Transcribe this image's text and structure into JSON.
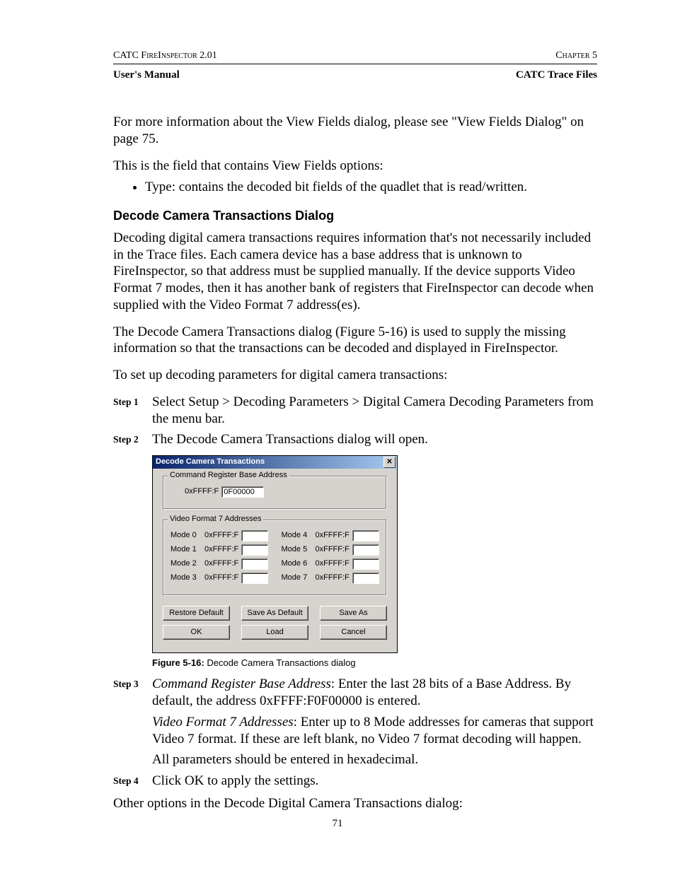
{
  "header": {
    "topLeft": "CATC FireInspector 2.01",
    "topRight": "Chapter 5",
    "bottomLeft": "User's Manual",
    "bottomRight": "CATC Trace Files"
  },
  "intro": {
    "p1": "For more information about the View Fields dialog, please see \"View Fields Dialog\" on page 75.",
    "p2": "This is the field that contains View Fields options:",
    "bullet1": "Type: contains the decoded bit fields of the quadlet that is read/written."
  },
  "section": {
    "title": "Decode Camera Transactions Dialog",
    "p1": "Decoding digital camera transactions requires information that's not necessarily included in the Trace files. Each camera device has a base address that is unknown to FireInspector, so that address must be supplied manually. If the device supports Video Format 7 modes, then it has another bank of registers that FireInspector can decode when supplied with the Video Format 7 address(es).",
    "p2": "The Decode Camera Transactions dialog (Figure 5-16) is used to supply the missing information so that the transactions can be decoded and displayed in FireInspector.",
    "p3": "To set up decoding parameters for digital camera transactions:"
  },
  "steps": {
    "s1": {
      "label": "Step 1",
      "text": "Select Setup > Decoding Parameters > Digital Camera Decoding Parameters from the menu bar."
    },
    "s2": {
      "label": "Step 2",
      "text": "The Decode Camera Transactions dialog will open."
    },
    "s3": {
      "label": "Step 3",
      "line1_italic": "Command Register Base Address",
      "line1_rest": ": Enter the last 28 bits of a Base Address. By default, the address 0xFFFF:F0F00000 is entered.",
      "line2_italic": "Video Format 7 Addresses",
      "line2_rest": ": Enter up to 8 Mode addresses for cameras that support Video 7 format. If these are left blank, no Video 7 format decoding will happen.",
      "line3": "All parameters should be entered in hexadecimal."
    },
    "s4": {
      "label": "Step 4",
      "text": "Click OK to apply the settings."
    }
  },
  "closing": "Other options in the Decode Digital Camera Transactions dialog:",
  "figure": {
    "captionNum": "Figure 5-16:",
    "captionText": "Decode Camera Transactions dialog"
  },
  "dialog": {
    "title": "Decode Camera Transactions",
    "group1": {
      "label": "Command Register Base Address",
      "prefix": "0xFFFF:F",
      "value": "0F00000"
    },
    "group2": {
      "label": "Video Format 7 Addresses",
      "modes": {
        "m0": {
          "label": "Mode 0",
          "prefix": "0xFFFF:F",
          "value": ""
        },
        "m1": {
          "label": "Mode 1",
          "prefix": "0xFFFF:F",
          "value": ""
        },
        "m2": {
          "label": "Mode 2",
          "prefix": "0xFFFF:F",
          "value": ""
        },
        "m3": {
          "label": "Mode 3",
          "prefix": "0xFFFF:F",
          "value": ""
        },
        "m4": {
          "label": "Mode 4",
          "prefix": "0xFFFF:F",
          "value": ""
        },
        "m5": {
          "label": "Mode 5",
          "prefix": "0xFFFF:F",
          "value": ""
        },
        "m6": {
          "label": "Mode 6",
          "prefix": "0xFFFF:F",
          "value": ""
        },
        "m7": {
          "label": "Mode 7",
          "prefix": "0xFFFF:F",
          "value": ""
        }
      }
    },
    "buttons": {
      "restore": "Restore Default",
      "saveDefault": "Save As Default",
      "saveAs": "Save As",
      "ok": "OK",
      "load": "Load",
      "cancel": "Cancel"
    }
  },
  "pageNumber": "71"
}
